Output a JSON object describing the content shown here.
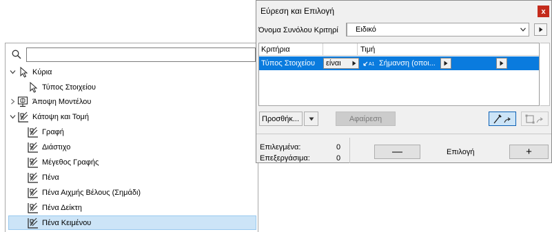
{
  "dialog": {
    "title": "Εύρεση και Επιλογή",
    "close_label": "x",
    "criteria_set_label": "Όνομα Συνόλου Κριτηρί",
    "criteria_set_value": "Ειδικό",
    "table": {
      "col_criteria": "Κριτήρια",
      "col_value": "Τιμή",
      "rows": [
        {
          "criterion": "Τύπος Στοιχείου",
          "operator": "είναι",
          "value": "Σήμανση (οποι..."
        }
      ]
    },
    "add_label": "Προσθήκ...",
    "remove_label": "Αφαίρεση",
    "selected_label": "Επιλεγμένα:",
    "selected_count": "0",
    "editable_label": "Επεξεργάσιμα:",
    "editable_count": "0",
    "minus_label": "—",
    "select_label": "Επιλογή",
    "plus_label": "+"
  },
  "tree": {
    "search_placeholder": "",
    "items": [
      {
        "label": "Κύρια",
        "expanded": true,
        "icon": "cursor-icon"
      },
      {
        "label": "Τύπος Στοιχείου",
        "icon": "cursor-icon"
      },
      {
        "label": "Άποψη Μοντέλου",
        "expanded": false,
        "icon": "model-view-icon"
      },
      {
        "label": "Κάτοψη και Τομή",
        "expanded": true,
        "icon": "plan-section-icon"
      },
      {
        "label": "Γραφή",
        "icon": "plan-section-icon"
      },
      {
        "label": "Διάστιχο",
        "icon": "plan-section-icon"
      },
      {
        "label": "Μέγεθος Γραφής",
        "icon": "plan-section-icon"
      },
      {
        "label": "Πένα",
        "icon": "plan-section-icon"
      },
      {
        "label": "Πένα Αιχμής Βέλους (Σημάδι)",
        "icon": "plan-section-icon"
      },
      {
        "label": "Πένα Δείκτη",
        "icon": "plan-section-icon"
      },
      {
        "label": "Πένα Κειμένου",
        "icon": "plan-section-icon",
        "selected": true
      }
    ]
  },
  "colors": {
    "selection_blue": "#0a7bde",
    "tree_selection": "#cce4f7",
    "close_red": "#c42b1c"
  }
}
